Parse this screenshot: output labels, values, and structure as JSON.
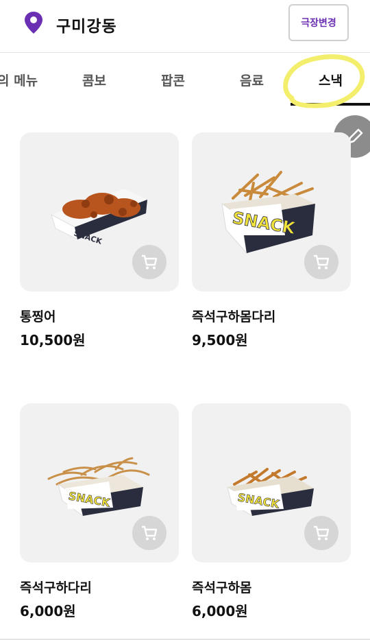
{
  "header": {
    "location": "구미강동",
    "change_button": "극장변경",
    "icon": "location-pin-icon",
    "accent": "#6b2fb3"
  },
  "tabs": [
    {
      "label": "의 메뉴"
    },
    {
      "label": "콤보"
    },
    {
      "label": "팝콘"
    },
    {
      "label": "음료"
    },
    {
      "label": "스낵",
      "active": true
    }
  ],
  "products": [
    {
      "name": "통찡어",
      "price": "10,500원",
      "box_text": "SNACK"
    },
    {
      "name": "즉석구하몸다리",
      "price": "9,500원",
      "box_text": "SNACK"
    },
    {
      "name": "즉석구하다리",
      "price": "6,000원",
      "box_text": "SNACK"
    },
    {
      "name": "즉석구하몸",
      "price": "6,000원",
      "box_text": "SNACK"
    }
  ]
}
